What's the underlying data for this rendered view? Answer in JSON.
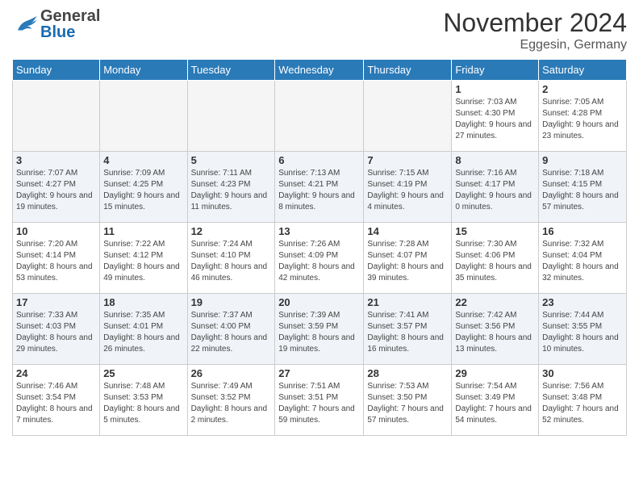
{
  "header": {
    "logo_general": "General",
    "logo_blue": "Blue",
    "month_title": "November 2024",
    "location": "Eggesin, Germany"
  },
  "weekdays": [
    "Sunday",
    "Monday",
    "Tuesday",
    "Wednesday",
    "Thursday",
    "Friday",
    "Saturday"
  ],
  "weeks": [
    [
      {
        "day": "",
        "empty": true
      },
      {
        "day": "",
        "empty": true
      },
      {
        "day": "",
        "empty": true
      },
      {
        "day": "",
        "empty": true
      },
      {
        "day": "",
        "empty": true
      },
      {
        "day": "1",
        "sunrise": "Sunrise: 7:03 AM",
        "sunset": "Sunset: 4:30 PM",
        "daylight": "Daylight: 9 hours and 27 minutes."
      },
      {
        "day": "2",
        "sunrise": "Sunrise: 7:05 AM",
        "sunset": "Sunset: 4:28 PM",
        "daylight": "Daylight: 9 hours and 23 minutes."
      }
    ],
    [
      {
        "day": "3",
        "sunrise": "Sunrise: 7:07 AM",
        "sunset": "Sunset: 4:27 PM",
        "daylight": "Daylight: 9 hours and 19 minutes."
      },
      {
        "day": "4",
        "sunrise": "Sunrise: 7:09 AM",
        "sunset": "Sunset: 4:25 PM",
        "daylight": "Daylight: 9 hours and 15 minutes."
      },
      {
        "day": "5",
        "sunrise": "Sunrise: 7:11 AM",
        "sunset": "Sunset: 4:23 PM",
        "daylight": "Daylight: 9 hours and 11 minutes."
      },
      {
        "day": "6",
        "sunrise": "Sunrise: 7:13 AM",
        "sunset": "Sunset: 4:21 PM",
        "daylight": "Daylight: 9 hours and 8 minutes."
      },
      {
        "day": "7",
        "sunrise": "Sunrise: 7:15 AM",
        "sunset": "Sunset: 4:19 PM",
        "daylight": "Daylight: 9 hours and 4 minutes."
      },
      {
        "day": "8",
        "sunrise": "Sunrise: 7:16 AM",
        "sunset": "Sunset: 4:17 PM",
        "daylight": "Daylight: 9 hours and 0 minutes."
      },
      {
        "day": "9",
        "sunrise": "Sunrise: 7:18 AM",
        "sunset": "Sunset: 4:15 PM",
        "daylight": "Daylight: 8 hours and 57 minutes."
      }
    ],
    [
      {
        "day": "10",
        "sunrise": "Sunrise: 7:20 AM",
        "sunset": "Sunset: 4:14 PM",
        "daylight": "Daylight: 8 hours and 53 minutes."
      },
      {
        "day": "11",
        "sunrise": "Sunrise: 7:22 AM",
        "sunset": "Sunset: 4:12 PM",
        "daylight": "Daylight: 8 hours and 49 minutes."
      },
      {
        "day": "12",
        "sunrise": "Sunrise: 7:24 AM",
        "sunset": "Sunset: 4:10 PM",
        "daylight": "Daylight: 8 hours and 46 minutes."
      },
      {
        "day": "13",
        "sunrise": "Sunrise: 7:26 AM",
        "sunset": "Sunset: 4:09 PM",
        "daylight": "Daylight: 8 hours and 42 minutes."
      },
      {
        "day": "14",
        "sunrise": "Sunrise: 7:28 AM",
        "sunset": "Sunset: 4:07 PM",
        "daylight": "Daylight: 8 hours and 39 minutes."
      },
      {
        "day": "15",
        "sunrise": "Sunrise: 7:30 AM",
        "sunset": "Sunset: 4:06 PM",
        "daylight": "Daylight: 8 hours and 35 minutes."
      },
      {
        "day": "16",
        "sunrise": "Sunrise: 7:32 AM",
        "sunset": "Sunset: 4:04 PM",
        "daylight": "Daylight: 8 hours and 32 minutes."
      }
    ],
    [
      {
        "day": "17",
        "sunrise": "Sunrise: 7:33 AM",
        "sunset": "Sunset: 4:03 PM",
        "daylight": "Daylight: 8 hours and 29 minutes."
      },
      {
        "day": "18",
        "sunrise": "Sunrise: 7:35 AM",
        "sunset": "Sunset: 4:01 PM",
        "daylight": "Daylight: 8 hours and 26 minutes."
      },
      {
        "day": "19",
        "sunrise": "Sunrise: 7:37 AM",
        "sunset": "Sunset: 4:00 PM",
        "daylight": "Daylight: 8 hours and 22 minutes."
      },
      {
        "day": "20",
        "sunrise": "Sunrise: 7:39 AM",
        "sunset": "Sunset: 3:59 PM",
        "daylight": "Daylight: 8 hours and 19 minutes."
      },
      {
        "day": "21",
        "sunrise": "Sunrise: 7:41 AM",
        "sunset": "Sunset: 3:57 PM",
        "daylight": "Daylight: 8 hours and 16 minutes."
      },
      {
        "day": "22",
        "sunrise": "Sunrise: 7:42 AM",
        "sunset": "Sunset: 3:56 PM",
        "daylight": "Daylight: 8 hours and 13 minutes."
      },
      {
        "day": "23",
        "sunrise": "Sunrise: 7:44 AM",
        "sunset": "Sunset: 3:55 PM",
        "daylight": "Daylight: 8 hours and 10 minutes."
      }
    ],
    [
      {
        "day": "24",
        "sunrise": "Sunrise: 7:46 AM",
        "sunset": "Sunset: 3:54 PM",
        "daylight": "Daylight: 8 hours and 7 minutes."
      },
      {
        "day": "25",
        "sunrise": "Sunrise: 7:48 AM",
        "sunset": "Sunset: 3:53 PM",
        "daylight": "Daylight: 8 hours and 5 minutes."
      },
      {
        "day": "26",
        "sunrise": "Sunrise: 7:49 AM",
        "sunset": "Sunset: 3:52 PM",
        "daylight": "Daylight: 8 hours and 2 minutes."
      },
      {
        "day": "27",
        "sunrise": "Sunrise: 7:51 AM",
        "sunset": "Sunset: 3:51 PM",
        "daylight": "Daylight: 7 hours and 59 minutes."
      },
      {
        "day": "28",
        "sunrise": "Sunrise: 7:53 AM",
        "sunset": "Sunset: 3:50 PM",
        "daylight": "Daylight: 7 hours and 57 minutes."
      },
      {
        "day": "29",
        "sunrise": "Sunrise: 7:54 AM",
        "sunset": "Sunset: 3:49 PM",
        "daylight": "Daylight: 7 hours and 54 minutes."
      },
      {
        "day": "30",
        "sunrise": "Sunrise: 7:56 AM",
        "sunset": "Sunset: 3:48 PM",
        "daylight": "Daylight: 7 hours and 52 minutes."
      }
    ]
  ]
}
